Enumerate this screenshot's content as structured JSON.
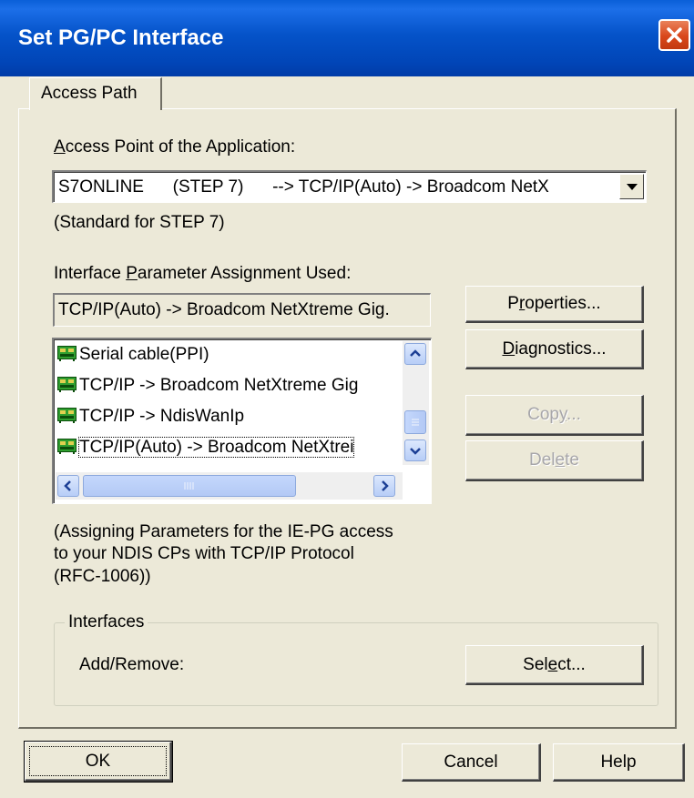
{
  "window": {
    "title": "Set PG/PC Interface"
  },
  "tab": {
    "label": "Access Path"
  },
  "access_point": {
    "label_prefix": "",
    "label_hotkey": "A",
    "label_rest": "ccess Point of the Application:",
    "value": "S7ONLINE      (STEP 7)      --> TCP/IP(Auto) -> Broadcom NetX",
    "note": "(Standard for STEP 7)"
  },
  "param_assign": {
    "label_prefix": "Interface ",
    "label_hotkey": "P",
    "label_rest": "arameter Assignment Used:",
    "value": "TCP/IP(Auto) -> Broadcom NetXtreme Gig."
  },
  "list": {
    "items": [
      "Serial cable(PPI)",
      "TCP/IP -> Broadcom NetXtreme Gig",
      "TCP/IP -> NdisWanIp",
      "TCP/IP(Auto) -> Broadcom NetXtrei"
    ]
  },
  "description": {
    "line1": "(Assigning Parameters for the IE-PG access",
    "line2": "to your NDIS CPs with TCP/IP Protocol",
    "line3": "(RFC-1006))"
  },
  "buttons": {
    "properties": {
      "pre": "P",
      "hot": "r",
      "post": "operties..."
    },
    "diagnostics": {
      "pre": "",
      "hot": "D",
      "post": "iagnostics..."
    },
    "copy": {
      "pre": "Cop",
      "hot": "y",
      "post": "..."
    },
    "delete": {
      "pre": "Del",
      "hot": "e",
      "post": "te"
    },
    "select": {
      "pre": "Sel",
      "hot": "e",
      "post": "ct..."
    },
    "ok": "OK",
    "cancel": "Cancel",
    "help": "Help"
  },
  "interfaces": {
    "group_label": "Interfaces",
    "add_remove": "Add/Remove:"
  },
  "colors": {
    "title_bar": "#0553C9",
    "dialog_bg": "#ECE9D8",
    "selection": "#316AC5"
  }
}
